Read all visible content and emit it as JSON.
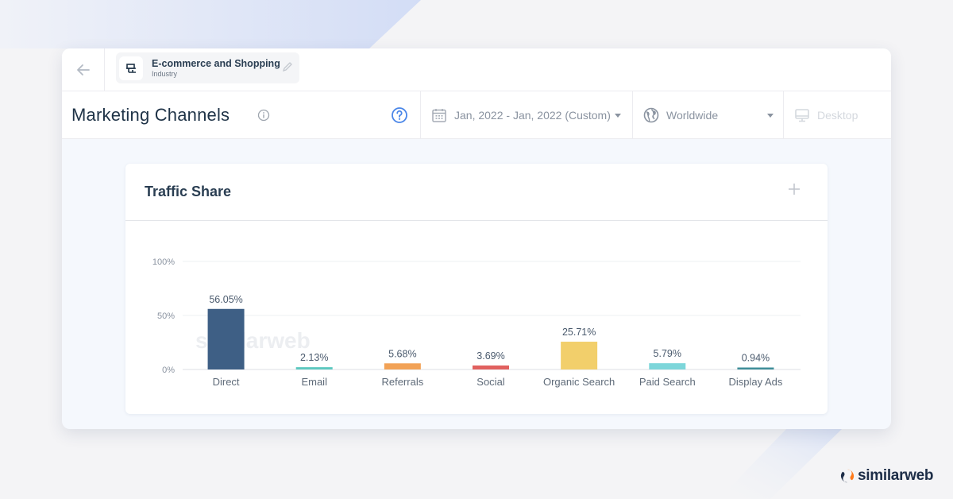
{
  "topbar": {
    "back_icon": "arrow-left-icon",
    "industry": {
      "icon": "shop-icon",
      "name": "E-commerce and Shopping",
      "type": "Industry",
      "edit_icon": "pencil-icon"
    }
  },
  "header": {
    "title": "Marketing Channels",
    "info_icon": "info-icon",
    "help_icon": "question-circle-icon",
    "filters": {
      "date": {
        "icon": "calendar-icon",
        "value": "Jan, 2022 - Jan, 2022 (Custom)"
      },
      "country": {
        "icon": "globe-icon",
        "value": "Worldwide"
      },
      "device": {
        "icon": "desktop-icon",
        "value": "Desktop"
      }
    }
  },
  "card": {
    "title": "Traffic Share",
    "add_icon": "plus-icon",
    "watermark": "similarweb"
  },
  "chart_data": {
    "type": "bar",
    "title": "Traffic Share",
    "xlabel": "",
    "ylabel": "",
    "categories": [
      "Direct",
      "Email",
      "Referrals",
      "Social",
      "Organic Search",
      "Paid Search",
      "Display Ads"
    ],
    "values": [
      56.05,
      2.13,
      5.68,
      3.69,
      25.71,
      5.79,
      0.94
    ],
    "value_labels": [
      "56.05%",
      "2.13%",
      "5.68%",
      "3.69%",
      "25.71%",
      "5.79%",
      "0.94%"
    ],
    "colors": [
      "#3e5f85",
      "#5dc8c0",
      "#f2a256",
      "#e1615f",
      "#f2cf6b",
      "#7dd6da",
      "#3f8e99"
    ],
    "yticks": [
      0,
      50,
      100
    ],
    "ytick_labels": [
      "0%",
      "50%",
      "100%"
    ],
    "ylim": [
      0,
      100
    ],
    "grid": true,
    "legend": "none"
  },
  "brand": {
    "name": "similarweb",
    "colors": {
      "orange": "#ff7a1a",
      "navy": "#1e2e48"
    }
  }
}
